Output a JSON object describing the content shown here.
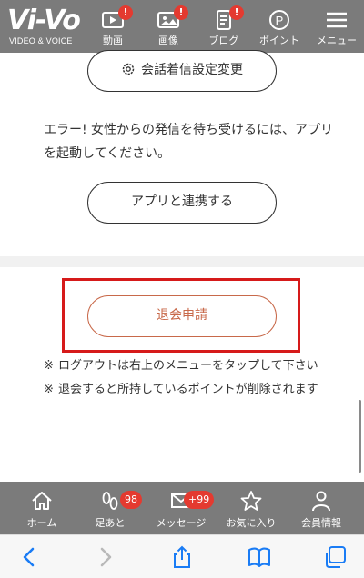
{
  "header": {
    "logo": {
      "main": "Vi-Vo",
      "sub": "VIDEO & VOICE"
    },
    "nav": [
      {
        "label": "動画",
        "icon": "video-icon",
        "badge": "!"
      },
      {
        "label": "画像",
        "icon": "image-icon",
        "badge": "!"
      },
      {
        "label": "ブログ",
        "icon": "blog-icon",
        "badge": "!"
      },
      {
        "label": "ポイント",
        "icon": "point-icon"
      },
      {
        "label": "メニュー",
        "icon": "menu-icon"
      }
    ]
  },
  "main": {
    "call_settings_button": "会話着信設定変更",
    "error_message": "エラー! 女性からの発信を待ち受けるには、アプリを起動してください。",
    "link_app_button": "アプリと連携する",
    "withdraw_button": "退会申請",
    "notes": [
      {
        "mark": "※",
        "text": "ログアウトは右上のメニューをタップして下さい"
      },
      {
        "mark": "※",
        "text": "退会すると所持しているポイントが削除されます"
      }
    ]
  },
  "tabbar": {
    "items": [
      {
        "label": "ホーム",
        "icon": "home-icon"
      },
      {
        "label": "足あと",
        "icon": "footprint-icon",
        "count": "98"
      },
      {
        "label": "メッセージ",
        "icon": "mail-icon",
        "count": "+99"
      },
      {
        "label": "お気に入り",
        "icon": "star-icon"
      },
      {
        "label": "会員情報",
        "icon": "person-icon"
      }
    ]
  },
  "browser_toolbar": {
    "items": [
      "back-icon",
      "forward-icon",
      "share-icon",
      "bookmarks-icon",
      "tabs-icon"
    ]
  },
  "colors": {
    "header_bg": "#7b7b7b",
    "badge": "#e43a30",
    "withdraw_accent": "#c8694a",
    "highlight_box": "#d61a1a",
    "browser_blue": "#1a7cf5"
  }
}
